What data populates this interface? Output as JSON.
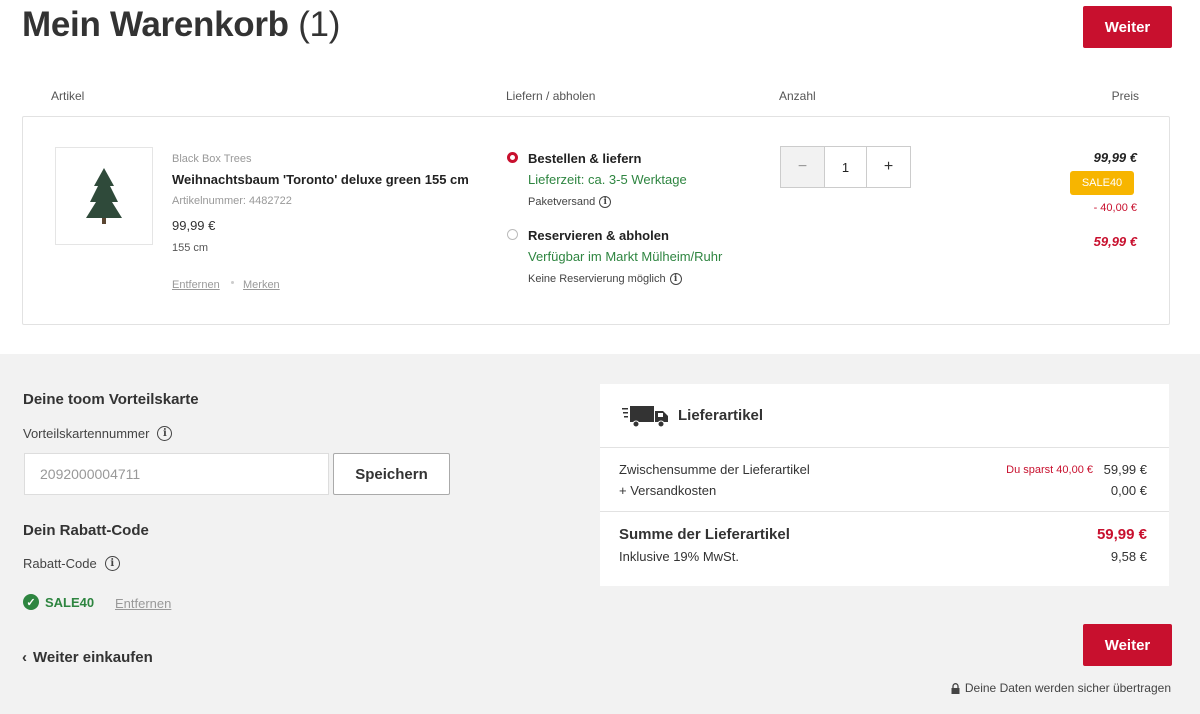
{
  "header": {
    "title": "Mein Warenkorb",
    "count": "(1)",
    "continue_label": "Weiter"
  },
  "columns": {
    "article": "Artikel",
    "delivery": "Liefern / abholen",
    "quantity": "Anzahl",
    "price": "Preis"
  },
  "item": {
    "brand": "Black Box Trees",
    "name": "Weihnachtsbaum 'Toronto' deluxe green 155 cm",
    "article_number": "Artikelnummer: 4482722",
    "unit_price": "99,99 €",
    "size": "155 cm",
    "remove_label": "Entfernen",
    "save_label": "Merken",
    "delivery_options": [
      {
        "title": "Bestellen & liefern",
        "detail": "Lieferzeit: ca. 3-5 Werktage",
        "note": "Paketversand",
        "selected": true
      },
      {
        "title": "Reservieren & abholen",
        "detail": "Verfügbar im Markt Mülheim/Ruhr",
        "note": "Keine Reservierung möglich",
        "selected": false
      }
    ],
    "quantity": "1",
    "qty_minus": "−",
    "qty_plus": "+",
    "price_original": "99,99 €",
    "badge": "SALE40",
    "discount": "- 40,00 €",
    "price_final": "59,99 €"
  },
  "loyalty": {
    "title": "Deine toom Vorteilskarte",
    "label": "Vorteilskartennummer",
    "value": "2092000004711",
    "save_button": "Speichern"
  },
  "coupon": {
    "title": "Dein Rabatt-Code",
    "label": "Rabatt-Code",
    "applied_code": "SALE40",
    "remove_label": "Entfernen"
  },
  "summary": {
    "title": "Lieferartikel",
    "subtotal_label": "Zwischensumme der Lieferartikel",
    "savings": "Du sparst 40,00 €",
    "subtotal_value": "59,99 €",
    "shipping_label": "+ Versandkosten",
    "shipping_value": "0,00 €",
    "total_label": "Summe der Lieferartikel",
    "total_value": "59,99 €",
    "vat_label": "Inklusive 19% MwSt.",
    "vat_value": "9,58 €"
  },
  "footer": {
    "back_label": "Weiter einkaufen",
    "continue_label": "Weiter",
    "secure_note": "Deine Daten werden sicher übertragen"
  },
  "colors": {
    "accent": "#c8102e",
    "success": "#2e8540",
    "badge": "#f7b500"
  }
}
